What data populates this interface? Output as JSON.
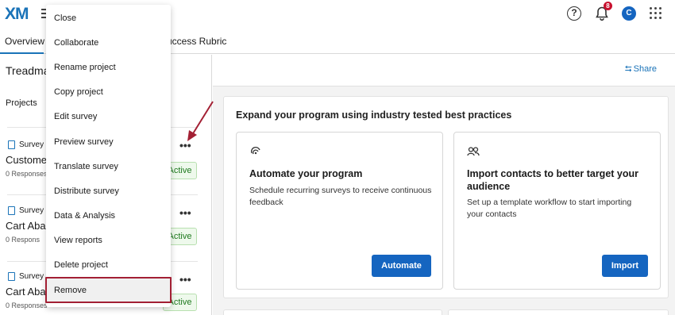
{
  "app": {
    "logo": "XM"
  },
  "topbar": {
    "notification_count": "8",
    "avatar_initial": "C",
    "help_glyph": "?"
  },
  "tabs": [
    {
      "label": "Overview"
    },
    {
      "label": "uccess Rubric"
    }
  ],
  "left_panel": {
    "title": "Treadma",
    "projects_label": "Projects",
    "projects": [
      {
        "type": "Survey",
        "name": "Custome",
        "responses": "0 Responses",
        "status": "Active"
      },
      {
        "type": "Survey",
        "name": "Cart Abar",
        "responses": "0 Respons",
        "status": "Active"
      },
      {
        "type": "Survey",
        "name": "Cart Aba",
        "responses": "0 Responses",
        "status": "Active"
      }
    ]
  },
  "main": {
    "share_label": "Share",
    "expand_title": "Expand your program using industry tested best practices",
    "cards": [
      {
        "title": "Automate your program",
        "description": "Schedule recurring surveys to receive continuous feedback",
        "button": "Automate"
      },
      {
        "title": "Import contacts to better target your audience",
        "description": "Set up a template workflow to start importing your contacts",
        "button": "Import"
      }
    ]
  },
  "menu": {
    "items": [
      "Close",
      "Collaborate",
      "Rename project",
      "Copy project",
      "Edit survey",
      "Preview survey",
      "Translate survey",
      "Distribute survey",
      "Data & Analysis",
      "View reports",
      "Delete project",
      "Remove"
    ],
    "highlighted": "Remove"
  },
  "colors": {
    "brand": "#1a73b8",
    "button": "#1565c0",
    "highlight_border": "#a32034",
    "arrow": "#a32034",
    "active_text": "#1f7a1f"
  }
}
